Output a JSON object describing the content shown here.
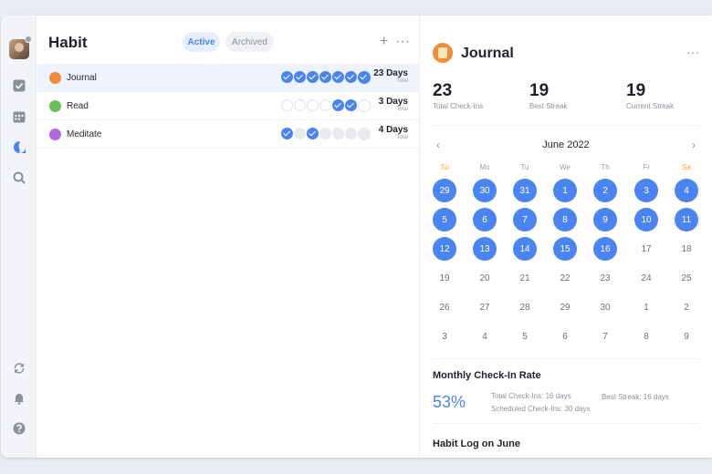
{
  "window": {
    "traffic_lights": [
      "#ff5f57",
      "#febc2e",
      "#28c840"
    ]
  },
  "sidebar": {
    "icons": [
      "checkbox-icon",
      "calendar-icon",
      "habit-icon",
      "search-icon",
      "sync-icon",
      "bell-icon",
      "help-icon"
    ],
    "accent": "#4a84f0"
  },
  "list": {
    "title": "Habit",
    "tabs": [
      {
        "label": "Active"
      },
      {
        "label": "Archived"
      }
    ],
    "add_label": "+",
    "more_label": "···",
    "habits": [
      {
        "name": "Journal",
        "icon_color": "#f08c3c",
        "days": "23 Days",
        "total": "Total",
        "week": [
          "done",
          "done",
          "done",
          "done",
          "done",
          "done",
          "done"
        ],
        "selected": true
      },
      {
        "name": "Read",
        "icon_color": "#6bbf59",
        "days": "3 Days",
        "total": "Total",
        "week": [
          "empty",
          "empty",
          "empty",
          "empty",
          "done",
          "done",
          "empty"
        ],
        "selected": false
      },
      {
        "name": "Meditate",
        "icon_color": "#b36ae0",
        "days": "4 Days",
        "total": "Total",
        "week": [
          "done",
          "gray",
          "done",
          "gray",
          "gray",
          "gray",
          "gray"
        ],
        "selected": false
      }
    ]
  },
  "detail": {
    "title": "Journal",
    "more_label": "···",
    "stats": [
      {
        "value": "23",
        "label": "Total Check-Ins"
      },
      {
        "value": "19",
        "label": "Best Streak"
      },
      {
        "value": "19",
        "label": "Current Streak"
      }
    ],
    "calendar": {
      "month": "June 2022",
      "prev": "‹",
      "next": "›",
      "weekdays": [
        "Su",
        "Mo",
        "Tu",
        "We",
        "Th",
        "Fr",
        "Sa"
      ],
      "weeks": [
        [
          {
            "d": "29",
            "on": true
          },
          {
            "d": "30",
            "on": true
          },
          {
            "d": "31",
            "on": true
          },
          {
            "d": "1",
            "on": true
          },
          {
            "d": "2",
            "on": true
          },
          {
            "d": "3",
            "on": true
          },
          {
            "d": "4",
            "on": true
          }
        ],
        [
          {
            "d": "5",
            "on": true
          },
          {
            "d": "6",
            "on": true
          },
          {
            "d": "7",
            "on": true
          },
          {
            "d": "8",
            "on": true
          },
          {
            "d": "9",
            "on": true
          },
          {
            "d": "10",
            "on": true
          },
          {
            "d": "11",
            "on": true
          }
        ],
        [
          {
            "d": "12",
            "on": true
          },
          {
            "d": "13",
            "on": true
          },
          {
            "d": "14",
            "on": true
          },
          {
            "d": "15",
            "on": true
          },
          {
            "d": "16",
            "on": true
          },
          {
            "d": "17",
            "on": false
          },
          {
            "d": "18",
            "on": false
          }
        ],
        [
          {
            "d": "19",
            "on": false
          },
          {
            "d": "20",
            "on": false
          },
          {
            "d": "21",
            "on": false
          },
          {
            "d": "22",
            "on": false
          },
          {
            "d": "23",
            "on": false
          },
          {
            "d": "24",
            "on": false
          },
          {
            "d": "25",
            "on": false
          }
        ],
        [
          {
            "d": "26",
            "on": false
          },
          {
            "d": "27",
            "on": false
          },
          {
            "d": "28",
            "on": false
          },
          {
            "d": "29",
            "on": false
          },
          {
            "d": "30",
            "on": false
          },
          {
            "d": "1",
            "on": false
          },
          {
            "d": "2",
            "on": false
          }
        ],
        [
          {
            "d": "3",
            "on": false
          },
          {
            "d": "4",
            "on": false
          },
          {
            "d": "5",
            "on": false
          },
          {
            "d": "6",
            "on": false
          },
          {
            "d": "7",
            "on": false
          },
          {
            "d": "8",
            "on": false
          },
          {
            "d": "9",
            "on": false
          }
        ]
      ]
    },
    "rate": {
      "title": "Monthly Check-In Rate",
      "value": "53%",
      "total": "Total Check-Ins: 16 days",
      "best": "Best Streak: 16 days",
      "scheduled": "Scheduled Check-Ins: 30 days"
    },
    "log_title": "Habit Log on June"
  }
}
